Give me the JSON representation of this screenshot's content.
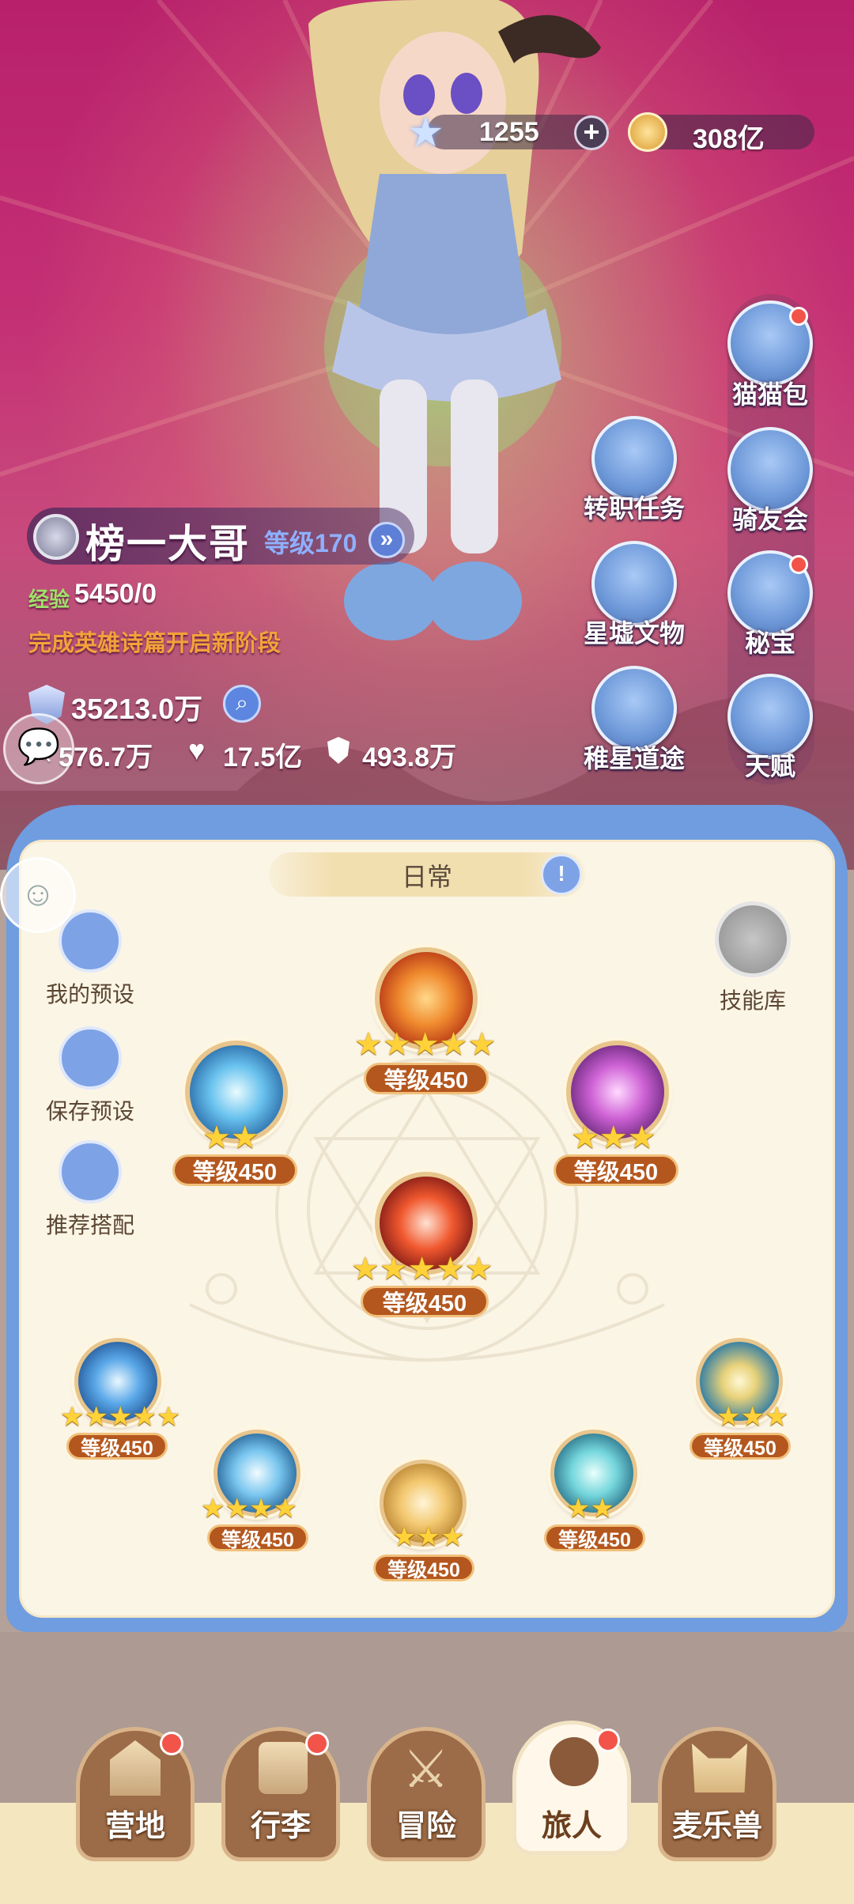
{
  "currency": {
    "stars": "1255",
    "gold": "308亿"
  },
  "player": {
    "name": "榜一大哥",
    "level": "等级170",
    "exp_label": "经验",
    "exp_value": "5450/0",
    "hint": "完成英雄诗篇开启新阶段",
    "power": "35213.0万",
    "attack": "576.7万",
    "hp": "17.5亿",
    "defense": "493.8万"
  },
  "side_menu": {
    "left": [
      {
        "label": "转职任务",
        "icon": "job-change-icon"
      },
      {
        "label": "星墟文物",
        "icon": "relic-icon"
      },
      {
        "label": "稚星道途",
        "icon": "star-path-icon"
      }
    ],
    "right": [
      {
        "label": "猫猫包",
        "icon": "cat-bag-icon",
        "dot": true
      },
      {
        "label": "骑友会",
        "icon": "horse-icon",
        "dot": false
      },
      {
        "label": "秘宝",
        "icon": "treasure-icon",
        "dot": true
      },
      {
        "label": "天赋",
        "icon": "talent-icon",
        "dot": false
      }
    ]
  },
  "panel": {
    "mode": "日常",
    "presets": {
      "my": "我的预设",
      "save": "保存预设",
      "recommend": "推荐搭配"
    },
    "library": "技能库",
    "skills": [
      {
        "level": "等级450",
        "stars": 5,
        "icon": "fire-burst-icon"
      },
      {
        "level": "等级450",
        "stars": 2,
        "icon": "ice-spikes-icon"
      },
      {
        "level": "等级450",
        "stars": 3,
        "icon": "target-icon"
      },
      {
        "level": "等级450",
        "stars": 5,
        "icon": "slash-icon"
      },
      {
        "level": "等级450",
        "stars": 5,
        "icon": "wind-blade-icon"
      },
      {
        "level": "等级450",
        "stars": 4,
        "icon": "frost-burst-icon"
      },
      {
        "level": "等级450",
        "stars": 3,
        "icon": "whirl-icon"
      },
      {
        "level": "等级450",
        "stars": 2,
        "icon": "eye-icon"
      },
      {
        "level": "等级450",
        "stars": 3,
        "icon": "vortex-icon"
      }
    ]
  },
  "nav": {
    "tabs": [
      {
        "label": "营地",
        "dot": true
      },
      {
        "label": "行李",
        "dot": true
      },
      {
        "label": "冒险",
        "dot": false
      },
      {
        "label": "旅人",
        "dot": true
      },
      {
        "label": "麦乐兽",
        "dot": false
      }
    ],
    "active": "旅人"
  },
  "colors": {
    "accent": "#b4571e",
    "panel_frame": "#6f9ddf",
    "star": "#ffd23a",
    "badge": "#f2544a"
  }
}
